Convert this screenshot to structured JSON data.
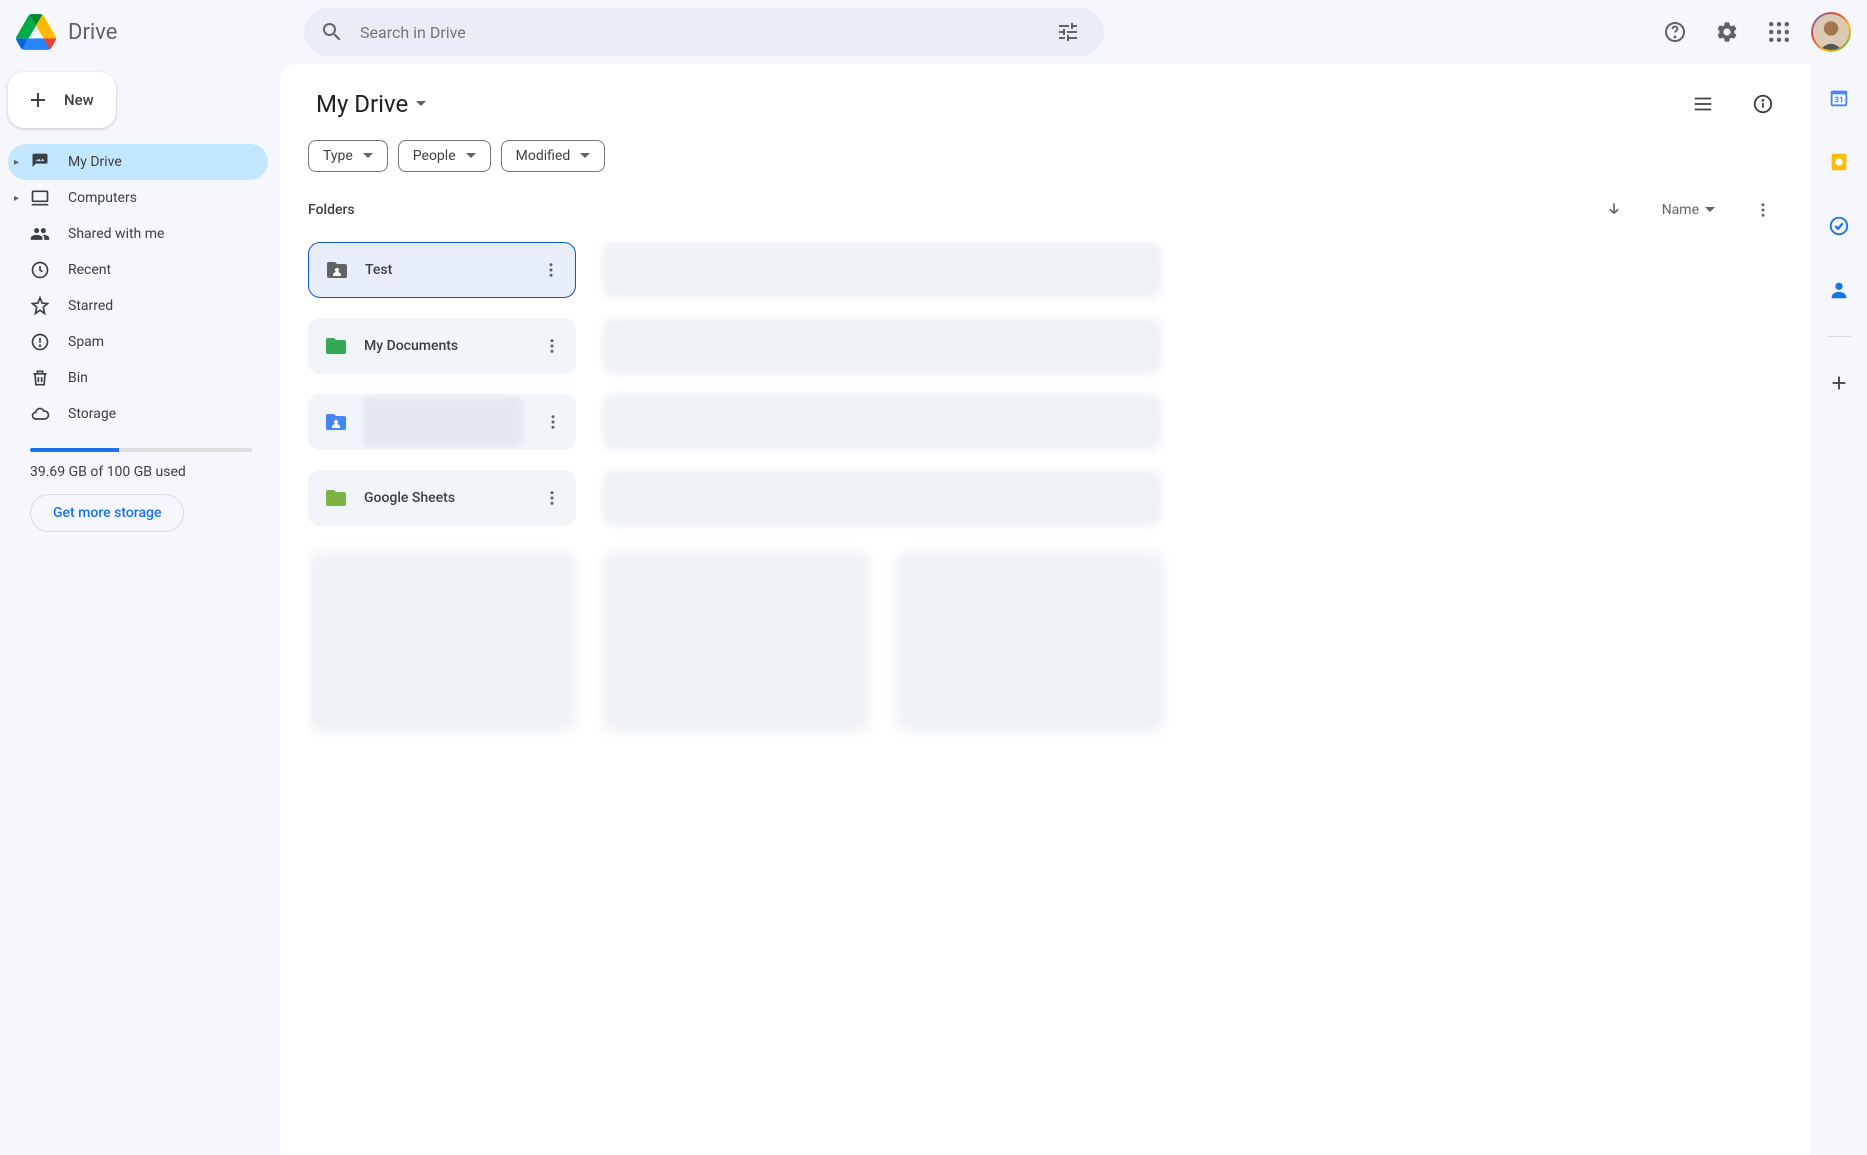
{
  "brand": "Drive",
  "search_placeholder": "Search in Drive",
  "new_button": "New",
  "sidebar": {
    "items": [
      {
        "label": "My Drive"
      },
      {
        "label": "Computers"
      },
      {
        "label": "Shared with me"
      },
      {
        "label": "Recent"
      },
      {
        "label": "Starred"
      },
      {
        "label": "Spam"
      },
      {
        "label": "Bin"
      },
      {
        "label": "Storage"
      }
    ],
    "storage_text": "39.69 GB of 100 GB used",
    "storage_percent": 40,
    "storage_button": "Get more storage"
  },
  "breadcrumb": "My Drive",
  "filters": [
    {
      "label": "Type"
    },
    {
      "label": "People"
    },
    {
      "label": "Modified"
    }
  ],
  "section_label": "Folders",
  "sort_label": "Name",
  "folders": [
    {
      "name": "Test",
      "color": "#5f6368",
      "shared": true,
      "selected": true
    },
    {
      "name": "My Documents",
      "color": "#34a853",
      "shared": false
    },
    {
      "name": "",
      "color": "#4285f4",
      "shared": true,
      "blurred": true
    },
    {
      "name": "Google Sheets",
      "color": "#7cb342",
      "shared": false
    }
  ]
}
